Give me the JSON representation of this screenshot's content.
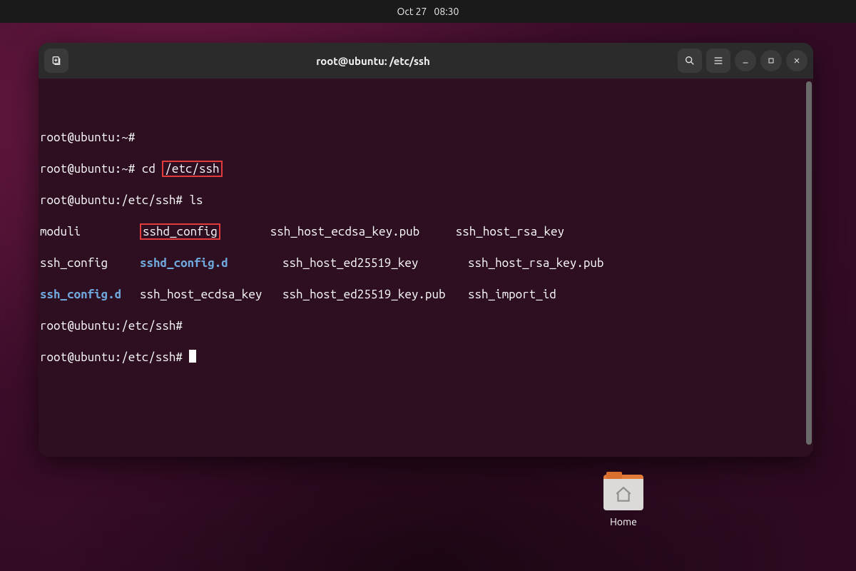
{
  "topbar": {
    "date": "Oct 27",
    "time": "08:30"
  },
  "window": {
    "title": "root@ubuntu: /etc/ssh"
  },
  "terminal": {
    "prompt_home": "root@ubuntu:~#",
    "prompt_ssh": "root@ubuntu:/etc/ssh#",
    "cmd_cd": "cd",
    "cd_arg": "/etc/ssh",
    "cmd_ls": "ls",
    "ls_row1": {
      "c1": "moduli",
      "c2": "sshd_config",
      "c3": "ssh_host_ecdsa_key.pub",
      "c4": "ssh_host_rsa_key"
    },
    "ls_row2": {
      "c1": "ssh_config",
      "c2": "sshd_config.d",
      "c3": "ssh_host_ed25519_key",
      "c4": "ssh_host_rsa_key.pub"
    },
    "ls_row3": {
      "c1": "ssh_config.d",
      "c2": "ssh_host_ecdsa_key",
      "c3": "ssh_host_ed25519_key.pub",
      "c4": "ssh_import_id"
    }
  },
  "desktop": {
    "home_label": "Home"
  }
}
